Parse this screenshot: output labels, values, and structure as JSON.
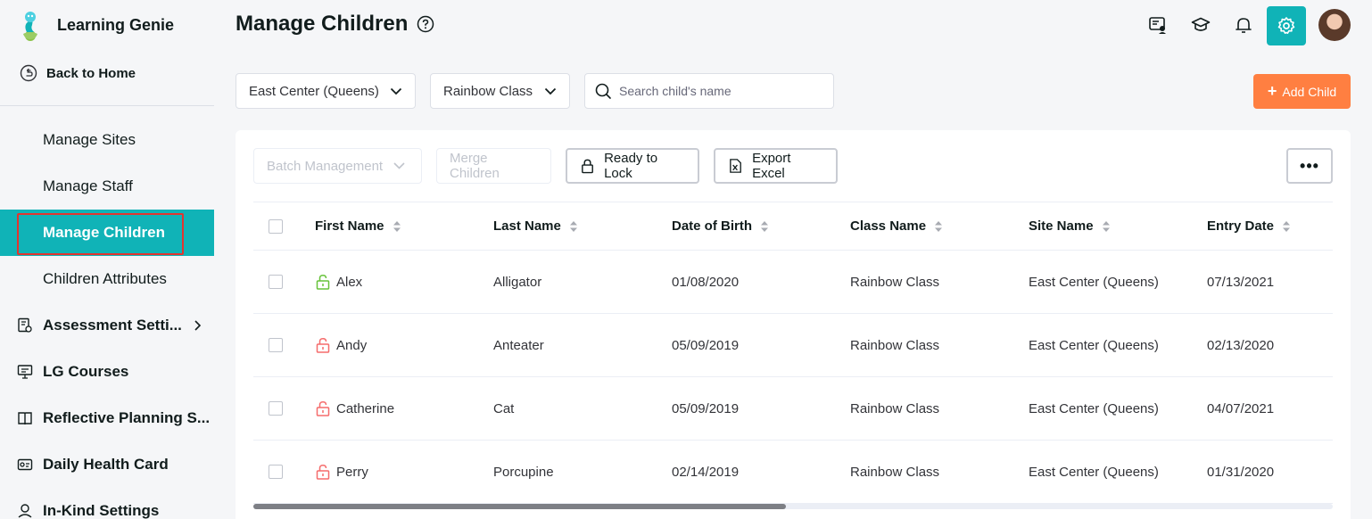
{
  "brand": {
    "name": "Learning Genie"
  },
  "sidebar": {
    "back_label": "Back to Home",
    "sub_items": [
      {
        "label": "Manage Sites"
      },
      {
        "label": "Manage Staff"
      },
      {
        "label": "Manage Children",
        "active": true
      },
      {
        "label": "Children Attributes"
      }
    ],
    "main_items": [
      {
        "label": "Assessment Setti...",
        "icon": "assessment-settings-icon",
        "has_chevron": true
      },
      {
        "label": "LG Courses",
        "icon": "courses-icon"
      },
      {
        "label": "Reflective Planning S...",
        "icon": "planning-icon"
      },
      {
        "label": "Daily Health Card",
        "icon": "health-card-icon"
      },
      {
        "label": "In-Kind Settings",
        "icon": "in-kind-icon"
      }
    ]
  },
  "header": {
    "title": "Manage Children",
    "icons": [
      "chat-icon",
      "graduation-cap-icon",
      "bell-icon",
      "gear-icon",
      "avatar"
    ]
  },
  "filters": {
    "site": "East Center (Queens)",
    "class": "Rainbow Class",
    "search_placeholder": "Search child's name",
    "add_label": "Add Child"
  },
  "toolbar": {
    "batch_label": "Batch Management",
    "merge_label": "Merge Children",
    "lock_label": "Ready to Lock",
    "export_label": "Export Excel",
    "more_label": "•••"
  },
  "table": {
    "columns": [
      "First Name",
      "Last Name",
      "Date of Birth",
      "Class Name",
      "Site Name",
      "Entry Date"
    ],
    "rows": [
      {
        "first": "Alex",
        "last": "Alligator",
        "dob": "01/08/2020",
        "class": "Rainbow Class",
        "site": "East Center (Queens)",
        "entry": "07/13/2021",
        "lock": "unlocked-green"
      },
      {
        "first": "Andy",
        "last": "Anteater",
        "dob": "05/09/2019",
        "class": "Rainbow Class",
        "site": "East Center (Queens)",
        "entry": "02/13/2020",
        "lock": "unlocked-red"
      },
      {
        "first": "Catherine",
        "last": "Cat",
        "dob": "05/09/2019",
        "class": "Rainbow Class",
        "site": "East Center (Queens)",
        "entry": "04/07/2021",
        "lock": "unlocked-red"
      },
      {
        "first": "Perry",
        "last": "Porcupine",
        "dob": "02/14/2019",
        "class": "Rainbow Class",
        "site": "East Center (Queens)",
        "entry": "01/31/2020",
        "lock": "unlocked-red"
      }
    ]
  },
  "colors": {
    "accent": "#10b3b7",
    "add_button": "#ff7f41",
    "lock_green": "#67c23a",
    "lock_red": "#f56c6c",
    "highlight_border": "#e3342f"
  }
}
